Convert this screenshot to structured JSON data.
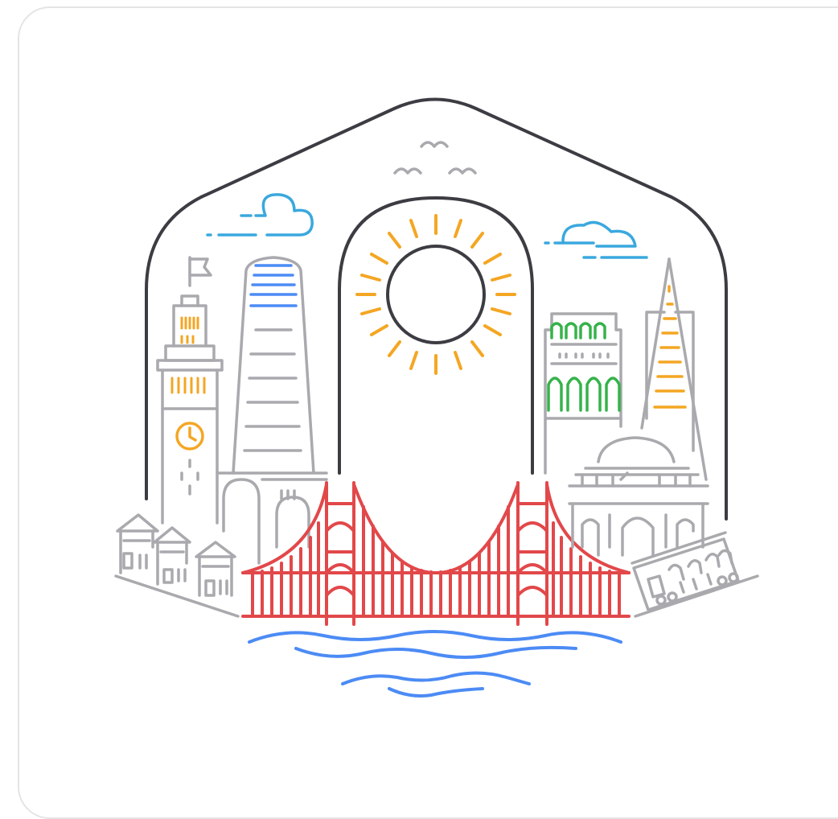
{
  "colors": {
    "outline": "#3c3c43",
    "building": "#a9a9ae",
    "bridge": "#e2484a",
    "water": "#4c8bf5",
    "sun": "#f4a623",
    "cloud": "#3aa8de",
    "green": "#35b34a",
    "blue": "#4c8bf5",
    "orange": "#f4a623",
    "border": "#e4e4e7"
  }
}
